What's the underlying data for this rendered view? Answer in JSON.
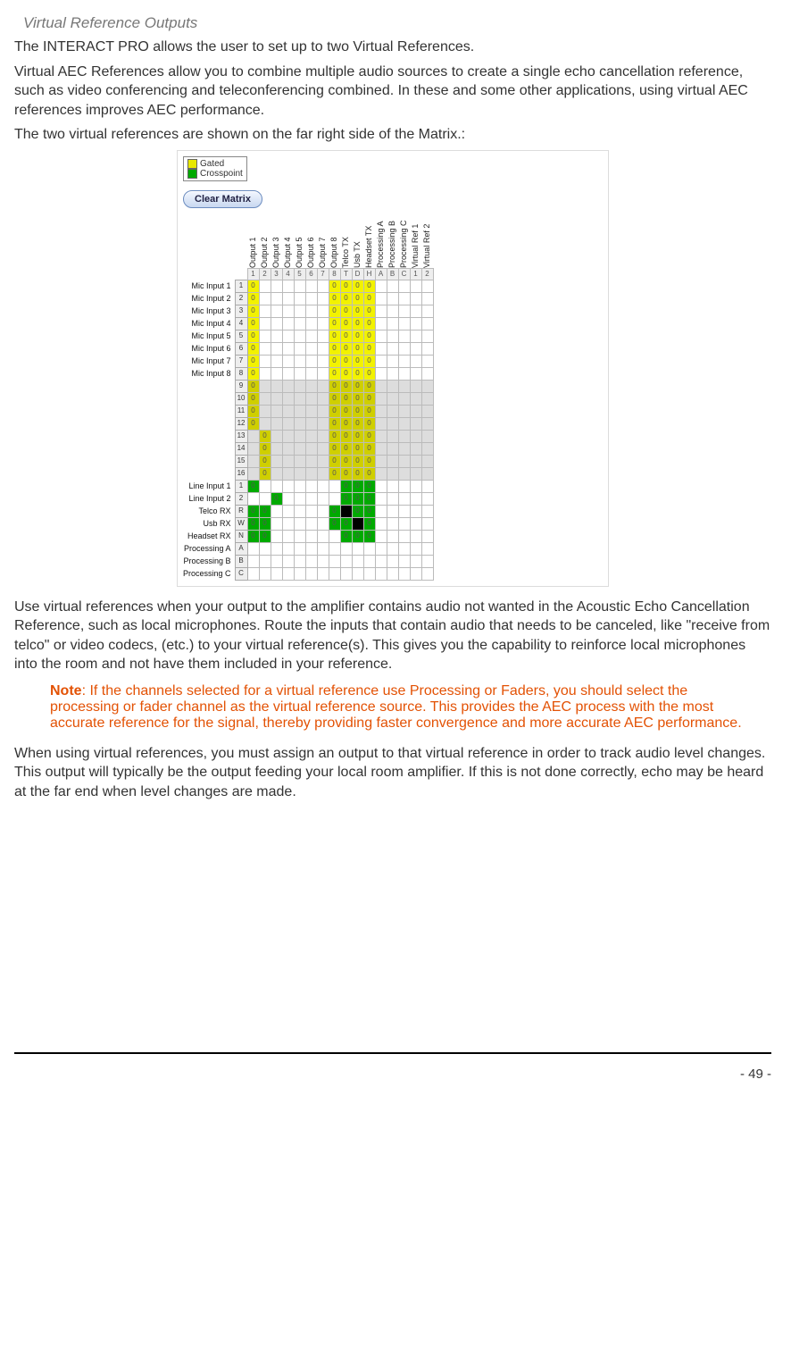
{
  "section_title": "Virtual Reference Outputs",
  "p1": "The INTERACT PRO allows the user to set up to two Virtual References.",
  "p2": "Virtual AEC References allow you to combine multiple audio sources to create a single echo cancellation reference, such as video conferencing and teleconferencing combined. In these and some other applications, using virtual AEC references improves AEC performance.",
  "p3": "The two virtual references are shown on the far right side of the Matrix.:",
  "legend": {
    "gated": "Gated",
    "crosspoint": "Crosspoint"
  },
  "clear_btn": "Clear Matrix",
  "cols": [
    "Output 1",
    "Output 2",
    "Output 3",
    "Output 4",
    "Output 5",
    "Output 6",
    "Output 7",
    "Output 8",
    "Telco TX",
    "Usb TX",
    "Headset TX",
    "Processing A",
    "Processing B",
    "Processing C",
    "Virtual Ref 1",
    "Virtual Ref 2"
  ],
  "col_nums": [
    "1",
    "2",
    "3",
    "4",
    "5",
    "6",
    "7",
    "8",
    "T",
    "D",
    "H",
    "A",
    "B",
    "C",
    "1",
    "2"
  ],
  "rows": [
    {
      "label": "Mic Input 1",
      "num": "1"
    },
    {
      "label": "Mic Input 2",
      "num": "2"
    },
    {
      "label": "Mic Input 3",
      "num": "3"
    },
    {
      "label": "Mic Input 4",
      "num": "4"
    },
    {
      "label": "Mic Input 5",
      "num": "5"
    },
    {
      "label": "Mic Input 6",
      "num": "6"
    },
    {
      "label": "Mic Input 7",
      "num": "7"
    },
    {
      "label": "Mic Input 8",
      "num": "8"
    },
    {
      "label": "",
      "num": "9",
      "grey": true
    },
    {
      "label": "",
      "num": "10",
      "grey": true
    },
    {
      "label": "",
      "num": "11",
      "grey": true
    },
    {
      "label": "",
      "num": "12",
      "grey": true
    },
    {
      "label": "",
      "num": "13",
      "grey": true
    },
    {
      "label": "",
      "num": "14",
      "grey": true
    },
    {
      "label": "",
      "num": "15",
      "grey": true
    },
    {
      "label": "",
      "num": "16",
      "grey": true
    },
    {
      "label": "Line Input 1",
      "num": "1"
    },
    {
      "label": "Line Input 2",
      "num": "2"
    },
    {
      "label": "Telco RX",
      "num": "R"
    },
    {
      "label": "Usb RX",
      "num": "W"
    },
    {
      "label": "Headset RX",
      "num": "N"
    },
    {
      "label": "Processing A",
      "num": "A"
    },
    {
      "label": "Processing B",
      "num": "B"
    },
    {
      "label": "Processing C",
      "num": "C"
    }
  ],
  "p4": "Use virtual references when your output to the amplifier contains audio not wanted in the Acoustic Echo Cancellation Reference, such as local microphones. Route the inputs that contain audio that needs to be canceled, like \"receive from telco\" or video codecs, (etc.) to your virtual reference(s). This gives you the capability to reinforce local microphones into the room and not have them included in your reference.",
  "note_label": "Note",
  "note_text": ": If the channels selected for a virtual reference use Processing or Faders, you should select the processing or fader channel as the virtual reference source. This provides the AEC process with the most accurate reference for the signal, thereby providing faster convergence and more accurate AEC performance.",
  "p5": "When using virtual references, you must assign an output to that virtual reference in order to track audio level changes. This output will typically be the output feeding your local room amplifier. If this is not done correctly, echo may be heard at the far end when level changes are made.",
  "page_number": "- 49 -"
}
